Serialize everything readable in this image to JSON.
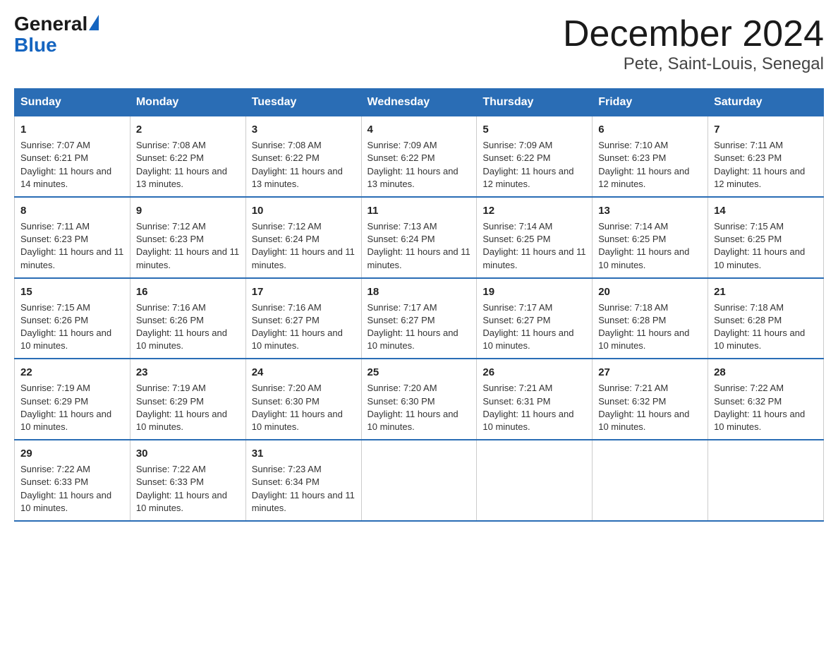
{
  "header": {
    "logo_general": "General",
    "logo_blue": "Blue",
    "month": "December 2024",
    "location": "Pete, Saint-Louis, Senegal"
  },
  "days_of_week": [
    "Sunday",
    "Monday",
    "Tuesday",
    "Wednesday",
    "Thursday",
    "Friday",
    "Saturday"
  ],
  "weeks": [
    [
      {
        "day": "1",
        "sunrise": "7:07 AM",
        "sunset": "6:21 PM",
        "daylight": "11 hours and 14 minutes."
      },
      {
        "day": "2",
        "sunrise": "7:08 AM",
        "sunset": "6:22 PM",
        "daylight": "11 hours and 13 minutes."
      },
      {
        "day": "3",
        "sunrise": "7:08 AM",
        "sunset": "6:22 PM",
        "daylight": "11 hours and 13 minutes."
      },
      {
        "day": "4",
        "sunrise": "7:09 AM",
        "sunset": "6:22 PM",
        "daylight": "11 hours and 13 minutes."
      },
      {
        "day": "5",
        "sunrise": "7:09 AM",
        "sunset": "6:22 PM",
        "daylight": "11 hours and 12 minutes."
      },
      {
        "day": "6",
        "sunrise": "7:10 AM",
        "sunset": "6:23 PM",
        "daylight": "11 hours and 12 minutes."
      },
      {
        "day": "7",
        "sunrise": "7:11 AM",
        "sunset": "6:23 PM",
        "daylight": "11 hours and 12 minutes."
      }
    ],
    [
      {
        "day": "8",
        "sunrise": "7:11 AM",
        "sunset": "6:23 PM",
        "daylight": "11 hours and 11 minutes."
      },
      {
        "day": "9",
        "sunrise": "7:12 AM",
        "sunset": "6:23 PM",
        "daylight": "11 hours and 11 minutes."
      },
      {
        "day": "10",
        "sunrise": "7:12 AM",
        "sunset": "6:24 PM",
        "daylight": "11 hours and 11 minutes."
      },
      {
        "day": "11",
        "sunrise": "7:13 AM",
        "sunset": "6:24 PM",
        "daylight": "11 hours and 11 minutes."
      },
      {
        "day": "12",
        "sunrise": "7:14 AM",
        "sunset": "6:25 PM",
        "daylight": "11 hours and 11 minutes."
      },
      {
        "day": "13",
        "sunrise": "7:14 AM",
        "sunset": "6:25 PM",
        "daylight": "11 hours and 10 minutes."
      },
      {
        "day": "14",
        "sunrise": "7:15 AM",
        "sunset": "6:25 PM",
        "daylight": "11 hours and 10 minutes."
      }
    ],
    [
      {
        "day": "15",
        "sunrise": "7:15 AM",
        "sunset": "6:26 PM",
        "daylight": "11 hours and 10 minutes."
      },
      {
        "day": "16",
        "sunrise": "7:16 AM",
        "sunset": "6:26 PM",
        "daylight": "11 hours and 10 minutes."
      },
      {
        "day": "17",
        "sunrise": "7:16 AM",
        "sunset": "6:27 PM",
        "daylight": "11 hours and 10 minutes."
      },
      {
        "day": "18",
        "sunrise": "7:17 AM",
        "sunset": "6:27 PM",
        "daylight": "11 hours and 10 minutes."
      },
      {
        "day": "19",
        "sunrise": "7:17 AM",
        "sunset": "6:27 PM",
        "daylight": "11 hours and 10 minutes."
      },
      {
        "day": "20",
        "sunrise": "7:18 AM",
        "sunset": "6:28 PM",
        "daylight": "11 hours and 10 minutes."
      },
      {
        "day": "21",
        "sunrise": "7:18 AM",
        "sunset": "6:28 PM",
        "daylight": "11 hours and 10 minutes."
      }
    ],
    [
      {
        "day": "22",
        "sunrise": "7:19 AM",
        "sunset": "6:29 PM",
        "daylight": "11 hours and 10 minutes."
      },
      {
        "day": "23",
        "sunrise": "7:19 AM",
        "sunset": "6:29 PM",
        "daylight": "11 hours and 10 minutes."
      },
      {
        "day": "24",
        "sunrise": "7:20 AM",
        "sunset": "6:30 PM",
        "daylight": "11 hours and 10 minutes."
      },
      {
        "day": "25",
        "sunrise": "7:20 AM",
        "sunset": "6:30 PM",
        "daylight": "11 hours and 10 minutes."
      },
      {
        "day": "26",
        "sunrise": "7:21 AM",
        "sunset": "6:31 PM",
        "daylight": "11 hours and 10 minutes."
      },
      {
        "day": "27",
        "sunrise": "7:21 AM",
        "sunset": "6:32 PM",
        "daylight": "11 hours and 10 minutes."
      },
      {
        "day": "28",
        "sunrise": "7:22 AM",
        "sunset": "6:32 PM",
        "daylight": "11 hours and 10 minutes."
      }
    ],
    [
      {
        "day": "29",
        "sunrise": "7:22 AM",
        "sunset": "6:33 PM",
        "daylight": "11 hours and 10 minutes."
      },
      {
        "day": "30",
        "sunrise": "7:22 AM",
        "sunset": "6:33 PM",
        "daylight": "11 hours and 10 minutes."
      },
      {
        "day": "31",
        "sunrise": "7:23 AM",
        "sunset": "6:34 PM",
        "daylight": "11 hours and 11 minutes."
      },
      null,
      null,
      null,
      null
    ]
  ]
}
